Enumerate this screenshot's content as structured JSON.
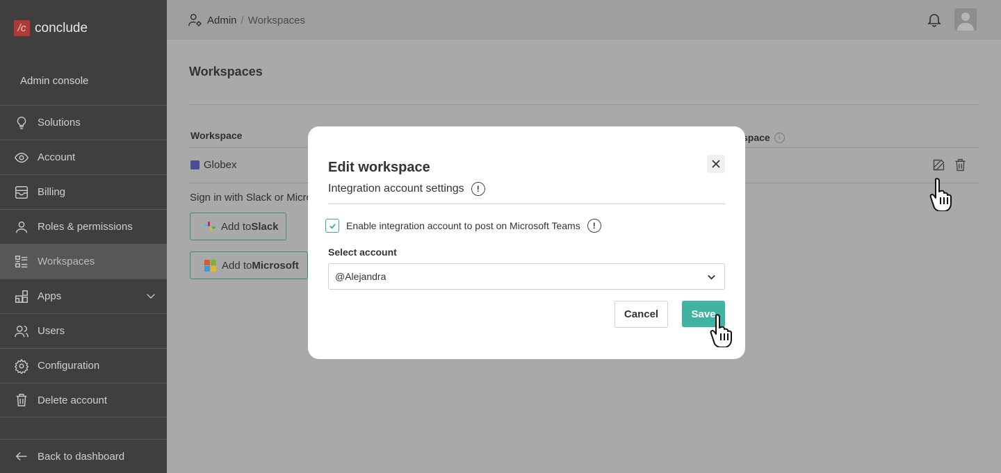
{
  "app": {
    "logo_mark": "/c",
    "name": "conclude",
    "console_label": "Admin console"
  },
  "sidebar": {
    "items": [
      {
        "label": "Solutions",
        "icon": "lightbulb-icon"
      },
      {
        "label": "Account",
        "icon": "eye-icon"
      },
      {
        "label": "Billing",
        "icon": "billing-icon"
      },
      {
        "label": "Roles & permissions",
        "icon": "person-icon"
      },
      {
        "label": "Workspaces",
        "icon": "list-icon",
        "active": true
      },
      {
        "label": "Apps",
        "icon": "apps-icon",
        "expandable": true
      },
      {
        "label": "Users",
        "icon": "users-icon"
      },
      {
        "label": "Configuration",
        "icon": "gear-icon"
      },
      {
        "label": "Delete account",
        "icon": "trash-icon"
      }
    ],
    "back_label": "Back to dashboard"
  },
  "breadcrumb": {
    "root": "Admin",
    "separator": "/",
    "current": "Workspaces"
  },
  "page": {
    "title": "Workspaces",
    "table_header_workspace": "Workspace",
    "table_header_right": "space",
    "rows": [
      {
        "name": "Globex",
        "platform_icon": "teams-icon"
      }
    ],
    "sign_in_text": "Sign in with Slack or Microsoft",
    "add_slack": {
      "prefix": "Add to ",
      "brand": "Slack"
    },
    "add_microsoft": {
      "prefix": "Add to ",
      "brand": "Microsoft"
    }
  },
  "modal": {
    "title": "Edit workspace",
    "subtitle": "Integration account settings",
    "info_glyph": "!",
    "checkbox_label": "Enable integration account to post on Microsoft Teams",
    "checkbox_checked": true,
    "select_label": "Select account",
    "select_value": "@Alejandra",
    "cancel_label": "Cancel",
    "save_label": "Save"
  },
  "colors": {
    "accent": "#41b3a3",
    "sidebar_bg": "#3f3f3f",
    "brand": "#b03a35"
  }
}
